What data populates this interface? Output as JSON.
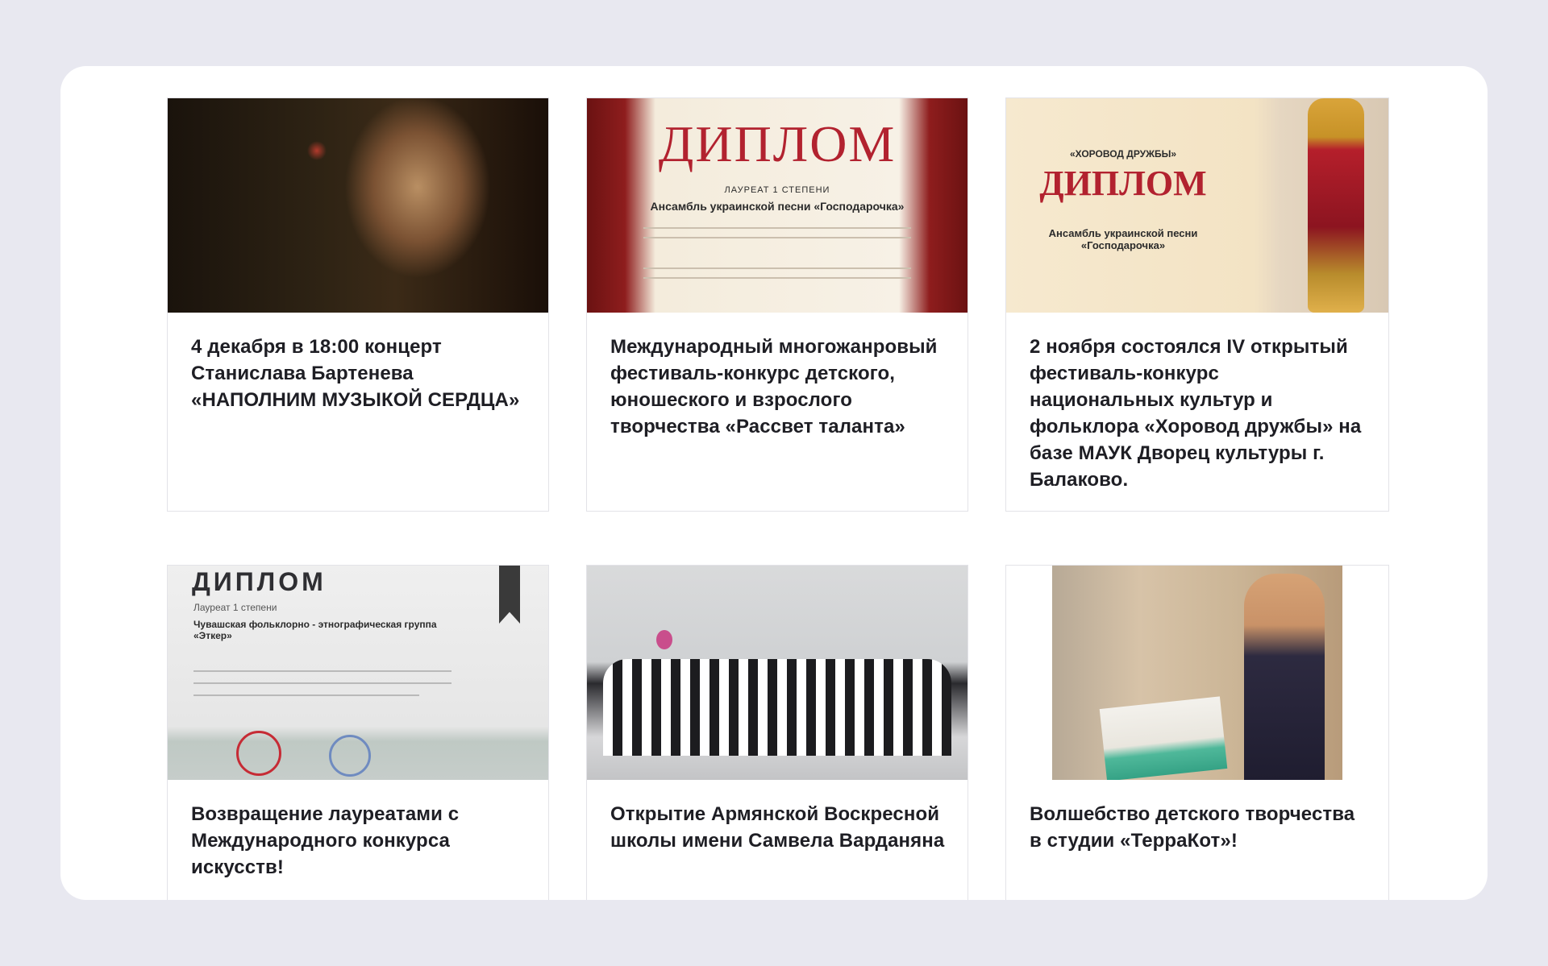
{
  "cards": [
    {
      "title": "4 декабря в 18:00 концерт Станислава Бартенева «НАПОЛНИМ МУЗЫКОЙ СЕРДЦА»"
    },
    {
      "title": "Международный многожанровый фестиваль-конкурс детского, юношеского и взрослого творчества «Рассвет таланта»",
      "image_text": {
        "heading": "ДИПЛОМ",
        "line1": "ЛАУРЕАТ 1 СТЕПЕНИ",
        "line2": "Ансамбль украинской песни «Господарочка»"
      }
    },
    {
      "title": "2 ноября состоялся IV открытый фестиваль-конкурс национальных культур и фольклора «Хоровод дружбы» на базе МАУК Дворец культуры г. Балаково.",
      "image_text": {
        "heading": "ДИПЛОМ",
        "line1": "«ХОРОВОД ДРУЖБЫ»",
        "line2": "Ансамбль украинской песни «Господарочка»"
      }
    },
    {
      "title": "Возвращение лауреатами с Международного конкурса искусств!",
      "image_text": {
        "heading": "ДИПЛОМ",
        "line1": "Лауреат 1 степени",
        "line2": "Чувашская фольклорно - этнографическая группа «Эткер»"
      }
    },
    {
      "title": "Открытие Армянской Воскресной школы имени Самвела Варданяна"
    },
    {
      "title": " Волшебство детского творчества в студии «ТерраКот»!"
    }
  ]
}
